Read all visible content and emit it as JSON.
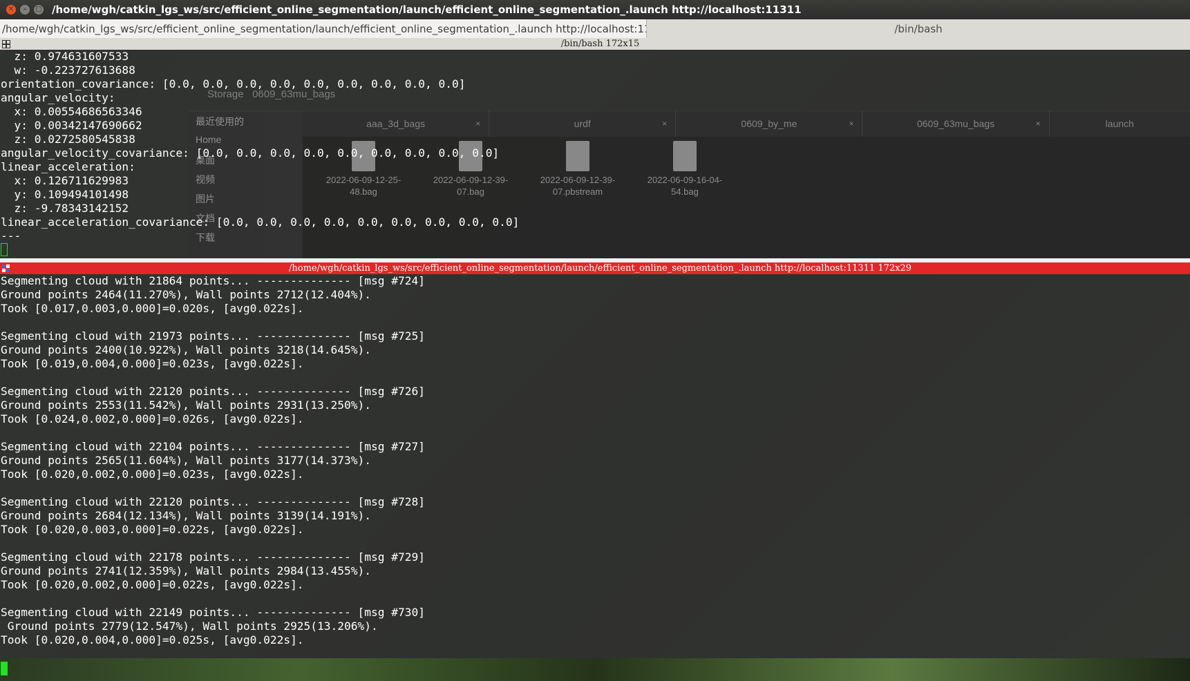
{
  "window": {
    "title": "/home/wgh/catkin_lgs_ws/src/efficient_online_segmentation/launch/efficient_online_segmentation_.launch http://localhost:11311"
  },
  "tabs": [
    {
      "label": "/home/wgh/catkin_lgs_ws/src/efficient_online_segmentation/launch/efficient_online_segmentation_.launch http://localhost:11311",
      "close": "✖"
    },
    {
      "label": "/bin/bash"
    }
  ],
  "top_pane": {
    "header": "/bin/bash 172x15",
    "lines": [
      "  z: 0.974631607533",
      "  w: -0.223727613688",
      "orientation_covariance: [0.0, 0.0, 0.0, 0.0, 0.0, 0.0, 0.0, 0.0, 0.0]",
      "angular_velocity:",
      "  x: 0.00554686563346",
      "  y: 0.00342147690662",
      "  z: 0.0272580545838",
      "angular_velocity_covariance: [0.0, 0.0, 0.0, 0.0, 0.0, 0.0, 0.0, 0.0, 0.0]",
      "linear_acceleration:",
      "  x: 0.126711629983",
      "  y: 0.109494101498",
      "  z: -9.78343142152",
      "linear_acceleration_covariance: [0.0, 0.0, 0.0, 0.0, 0.0, 0.0, 0.0, 0.0, 0.0]",
      "---"
    ]
  },
  "bottom_pane": {
    "header": "/home/wgh/catkin_lgs_ws/src/efficient_online_segmentation/launch/efficient_online_segmentation_.launch http://localhost:11311 172x29",
    "lines": [
      "Segmenting cloud with 21864 points... -------------- [msg #724]",
      "Ground points 2464(11.270%), Wall points 2712(12.404%).",
      "Took [0.017,0.003,0.000]=0.020s, [avg0.022s].",
      "",
      "Segmenting cloud with 21973 points... -------------- [msg #725]",
      "Ground points 2400(10.922%), Wall points 3218(14.645%).",
      "Took [0.019,0.004,0.000]=0.023s, [avg0.022s].",
      "",
      "Segmenting cloud with 22120 points... -------------- [msg #726]",
      "Ground points 2553(11.542%), Wall points 2931(13.250%).",
      "Took [0.024,0.002,0.000]=0.026s, [avg0.022s].",
      "",
      "Segmenting cloud with 22104 points... -------------- [msg #727]",
      "Ground points 2565(11.604%), Wall points 3177(14.373%).",
      "Took [0.020,0.002,0.000]=0.023s, [avg0.022s].",
      "",
      "Segmenting cloud with 22120 points... -------------- [msg #728]",
      "Ground points 2684(12.134%), Wall points 3139(14.191%).",
      "Took [0.020,0.003,0.000]=0.022s, [avg0.022s].",
      "",
      "Segmenting cloud with 22178 points... -------------- [msg #729]",
      "Ground points 2741(12.359%), Wall points 2984(13.455%).",
      "Took [0.020,0.002,0.000]=0.022s, [avg0.022s].",
      "",
      "Segmenting cloud with 22149 points... -------------- [msg #730]",
      " Ground points 2779(12.547%), Wall points 2925(13.206%).",
      "Took [0.020,0.004,0.000]=0.025s, [avg0.022s]."
    ]
  },
  "background_file_manager": {
    "path_label": "Storage",
    "path_folder": "0609_63mu_bags",
    "sidebar": [
      "最近使用的",
      "Home",
      "桌面",
      "视频",
      "图片",
      "文档",
      "下载"
    ],
    "tabs": [
      "aaa_3d_bags",
      "urdf",
      "0609_by_me",
      "0609_63mu_bags",
      "launch"
    ],
    "files": [
      "2022-06-09-12-25-48.bag",
      "2022-06-09-12-39-07.bag",
      "2022-06-09-12-39-07.pbstream",
      "2022-06-09-16-04-54.bag"
    ]
  },
  "colors": {
    "terminal_bg": "#303030",
    "terminal_fg": "#ffffff",
    "cursor": "#22e022",
    "active_pane_header": "#e3262a",
    "titlebar": "#2d2d2b",
    "close_button": "#e95420"
  }
}
